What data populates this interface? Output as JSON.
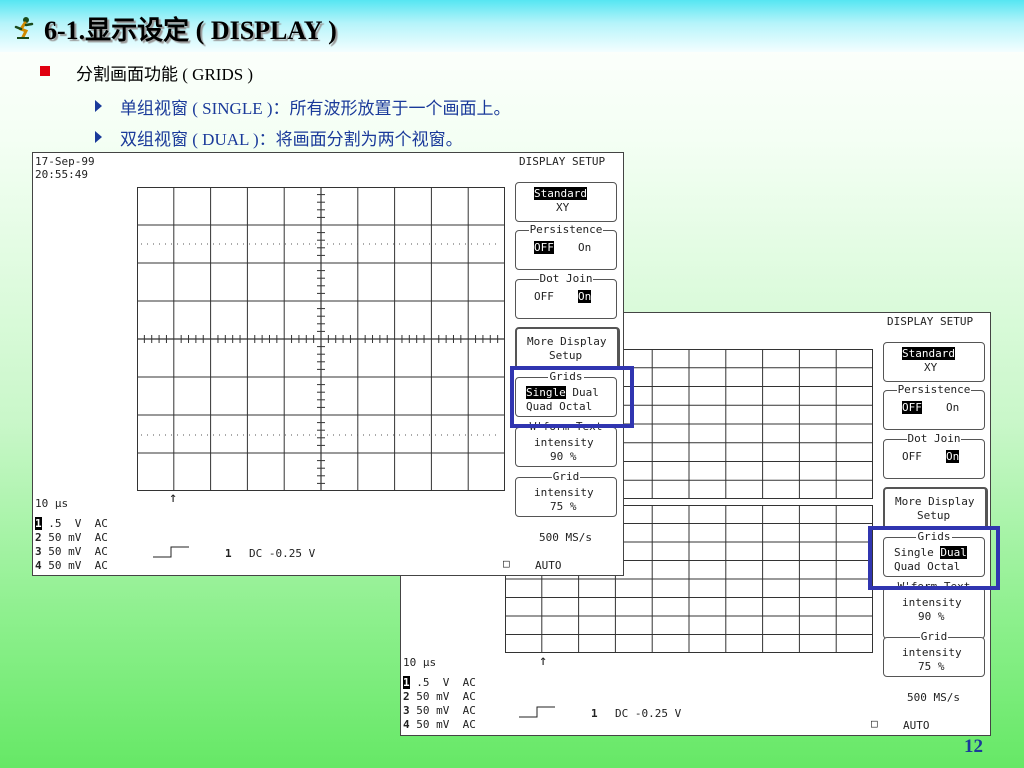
{
  "slide": {
    "title": "6-1.显示设定 ( DISPLAY )",
    "bullet": "分割画面功能 ( GRIDS )",
    "sub_items": [
      "单组视窗 ( SINGLE )：所有波形放置于一个画面上。",
      "双组视窗 ( DUAL )：将画面分割为两个视窗。"
    ],
    "page_number": "12"
  },
  "colors": {
    "accent_blue": "#1a3a9a",
    "highlight": "#3035b0",
    "bullet_red": "#e00010"
  },
  "scope_single": {
    "date": "17-Sep-99",
    "time": "20:55:49",
    "menu_title": "DISPLAY SETUP",
    "std_sel": "Standard",
    "std_other": "XY",
    "persist_label": "Persistence",
    "persist_sel": "OFF",
    "persist_other": "On",
    "dot_label": "Dot Join",
    "dot_other": "OFF",
    "dot_sel": "On",
    "more_line1": "More Display",
    "more_line2": "Setup",
    "grids_label": "Grids",
    "grids_sel": "Single",
    "grids_dual": "Dual",
    "grids_row2": "Quad Octal",
    "wf_label": "W'form Text",
    "wf_line2": "intensity",
    "wf_val": "90 %",
    "grid_label": "Grid",
    "grid_line2": "intensity",
    "grid_val": "75 %",
    "timebase": "10 µs",
    "ch1_num": "1",
    "ch1": " .5  V  AC",
    "ch2_num": "2",
    "ch2": " 50 mV  AC",
    "ch3_num": "3",
    "ch3": " 50 mV  AC",
    "ch4_num": "4",
    "ch4": " 50 mV  AC",
    "trig_ch": "1",
    "trig_text": "DC -0.25 V",
    "rate": "500 MS/s",
    "auto_box": "□",
    "auto": "AUTO"
  },
  "scope_dual": {
    "menu_title": "DISPLAY SETUP",
    "std_sel": "Standard",
    "std_other": "XY",
    "persist_label": "Persistence",
    "persist_sel": "OFF",
    "persist_other": "On",
    "dot_label": "Dot Join",
    "dot_other": "OFF",
    "dot_sel": "On",
    "more_line1": "More Display",
    "more_line2": "Setup",
    "grids_label": "Grids",
    "grids_single": "Single",
    "grids_sel": "Dual",
    "grids_row2": "Quad Octal",
    "wf_label": "W'form Text",
    "wf_line2": "intensity",
    "wf_val": "90 %",
    "grid_label": "Grid",
    "grid_line2": "intensity",
    "grid_val": "75 %",
    "timebase": "10 µs",
    "ch1_num": "1",
    "ch1": " .5  V  AC",
    "ch2_num": "2",
    "ch2": " 50 mV  AC",
    "ch3_num": "3",
    "ch3": " 50 mV  AC",
    "ch4_num": "4",
    "ch4": " 50 mV  AC",
    "trig_ch": "1",
    "trig_text": "DC -0.25 V",
    "rate": "500 MS/s",
    "auto_box": "□",
    "auto": "AUTO"
  }
}
